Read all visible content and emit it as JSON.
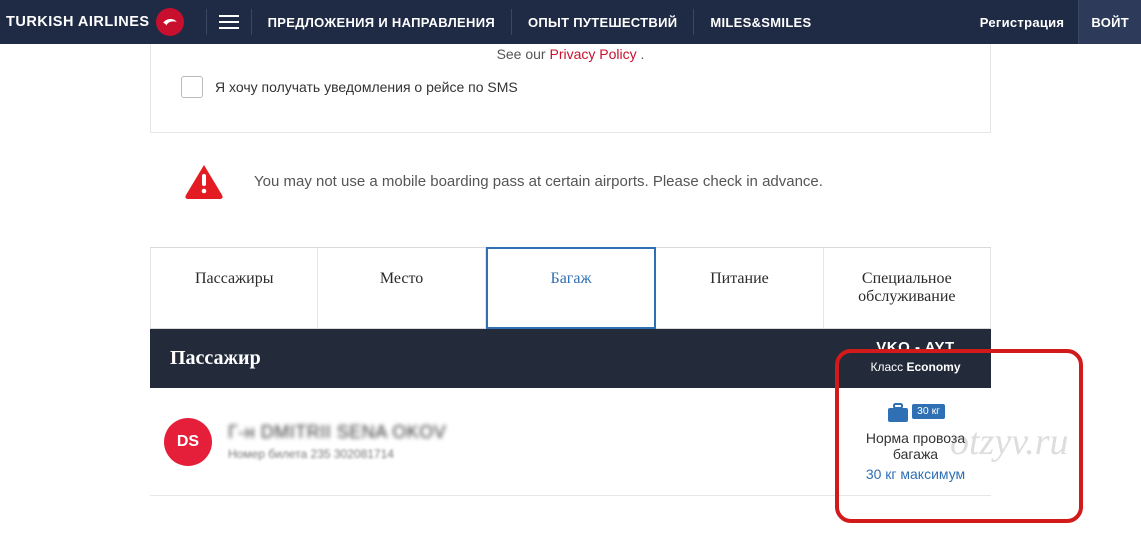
{
  "nav": {
    "brand": "TURKISH AIRLINES",
    "links": [
      "ПРЕДЛОЖЕНИЯ И НАПРАВЛЕНИЯ",
      "ОПЫТ ПУТЕШЕСТВИЙ",
      "MILES&SMILES"
    ],
    "register": "Регистрация",
    "login": "ВОЙТ"
  },
  "privacy": {
    "prefix": "See our ",
    "link": "Privacy Policy",
    "suffix": "."
  },
  "consent": {
    "label": "Я хочу получать уведомления о рейсе по SMS"
  },
  "warning": {
    "text": "You may not use a mobile boarding pass at certain airports. Please check in advance."
  },
  "tabs": [
    "Пассажиры",
    "Место",
    "Багаж",
    "Питание",
    "Специальное обслуживание"
  ],
  "active_tab_index": 2,
  "header": {
    "passenger": "Пассажир",
    "route": "VKO - AYT",
    "class_label": "Класс",
    "class_value": "Economy"
  },
  "passenger": {
    "initials": "DS",
    "title_prefix": "Г-н",
    "name_blurred": "DMITRII SENA  OKOV",
    "ticket_label": "Номер билета",
    "ticket_number": "235 302081714"
  },
  "baggage": {
    "weight_tag": "30 кг",
    "norm_label": "Норма провоза багажа",
    "max_label": "30 кг максимум"
  },
  "watermark": "otzyv.ru"
}
